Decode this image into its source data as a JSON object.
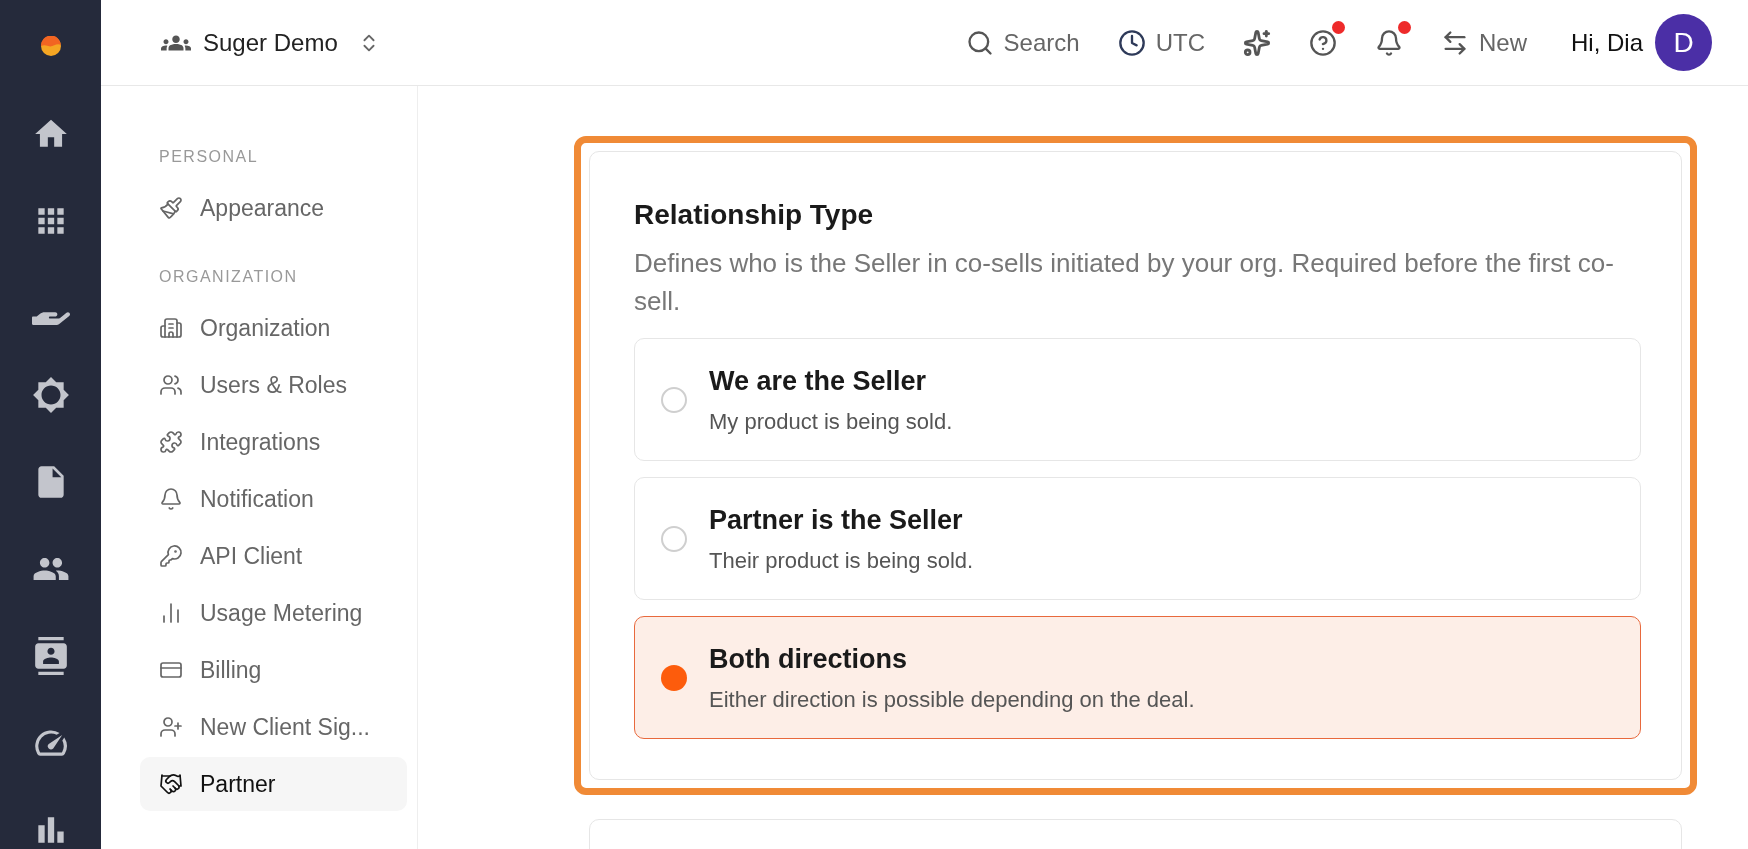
{
  "rail": {
    "items": [
      {
        "selected": false
      },
      {
        "selected": false
      },
      {
        "selected": false
      },
      {
        "selected": false
      },
      {
        "selected": false
      },
      {
        "selected": false
      },
      {
        "selected": false
      },
      {
        "selected": false
      },
      {
        "selected": false
      }
    ]
  },
  "topbar": {
    "workspace": "Suger Demo",
    "actions": [
      {
        "kind": "search",
        "label": "Search",
        "dot": false
      },
      {
        "kind": "clock",
        "label": "UTC",
        "dot": false
      },
      {
        "kind": "sparkles",
        "dot": false
      },
      {
        "kind": "help",
        "dot": true
      },
      {
        "kind": "bell",
        "dot": true
      },
      {
        "kind": "swap",
        "label": "New",
        "dot": false
      }
    ],
    "greeting": "Hi, Dia",
    "avatar": "D"
  },
  "sidebar": {
    "sections": [
      {
        "heading": "PERSONAL",
        "items": [
          {
            "label": "Appearance",
            "selected": false
          }
        ]
      },
      {
        "heading": "ORGANIZATION",
        "items": [
          {
            "label": "Organization",
            "selected": false
          },
          {
            "label": "Users & Roles",
            "selected": false
          },
          {
            "label": "Integrations",
            "selected": false
          },
          {
            "label": "Notification",
            "selected": false
          },
          {
            "label": "API Client",
            "selected": false
          },
          {
            "label": "Usage Metering",
            "selected": false
          },
          {
            "label": "Billing",
            "selected": false
          },
          {
            "label": "New Client Sig...",
            "selected": false
          },
          {
            "label": "Partner",
            "selected": true
          }
        ]
      }
    ]
  },
  "settings": {
    "title": "Relationship Type",
    "description": "Defines who is the Seller in co-sells initiated by your org. Required before the first co-sell.",
    "options": [
      {
        "title": "We are the Seller",
        "subtitle": "My product is being sold.",
        "selected": false
      },
      {
        "title": "Partner is the Seller",
        "subtitle": "Their product is being sold.",
        "selected": false
      },
      {
        "title": "Both directions",
        "subtitle": "Either direction is possible depending on the deal.",
        "selected": true
      }
    ]
  }
}
